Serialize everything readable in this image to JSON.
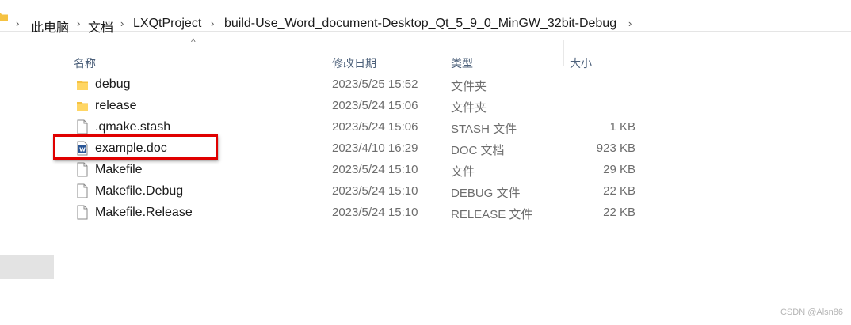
{
  "address_bar": {
    "crumbs": [
      "此电脑",
      "文档",
      "LXQtProject",
      "build-Use_Word_document-Desktop_Qt_5_9_0_MinGW_32bit-Debug"
    ]
  },
  "columns": {
    "name": "名称",
    "date": "修改日期",
    "type": "类型",
    "size": "大小"
  },
  "files": [
    {
      "name": "debug",
      "date": "2023/5/25 15:52",
      "type": "文件夹",
      "size": "",
      "icon": "folder-icon"
    },
    {
      "name": "release",
      "date": "2023/5/24 15:06",
      "type": "文件夹",
      "size": "",
      "icon": "folder-icon"
    },
    {
      "name": ".qmake.stash",
      "date": "2023/5/24 15:06",
      "type": "STASH 文件",
      "size": "1 KB",
      "icon": "file-icon"
    },
    {
      "name": "example.doc",
      "date": "2023/4/10 16:29",
      "type": "DOC 文档",
      "size": "923 KB",
      "icon": "word-document-icon"
    },
    {
      "name": "Makefile",
      "date": "2023/5/24 15:10",
      "type": "文件",
      "size": "29 KB",
      "icon": "file-icon"
    },
    {
      "name": "Makefile.Debug",
      "date": "2023/5/24 15:10",
      "type": "DEBUG 文件",
      "size": "22 KB",
      "icon": "file-icon"
    },
    {
      "name": "Makefile.Release",
      "date": "2023/5/24 15:10",
      "type": "RELEASE 文件",
      "size": "22 KB",
      "icon": "file-icon"
    }
  ],
  "highlighted_file": "example.doc",
  "colors": {
    "highlight_border": "#e00000",
    "folder": "#f5c242",
    "word_icon": "#2b5797"
  },
  "watermark": "CSDN @Alsn86"
}
